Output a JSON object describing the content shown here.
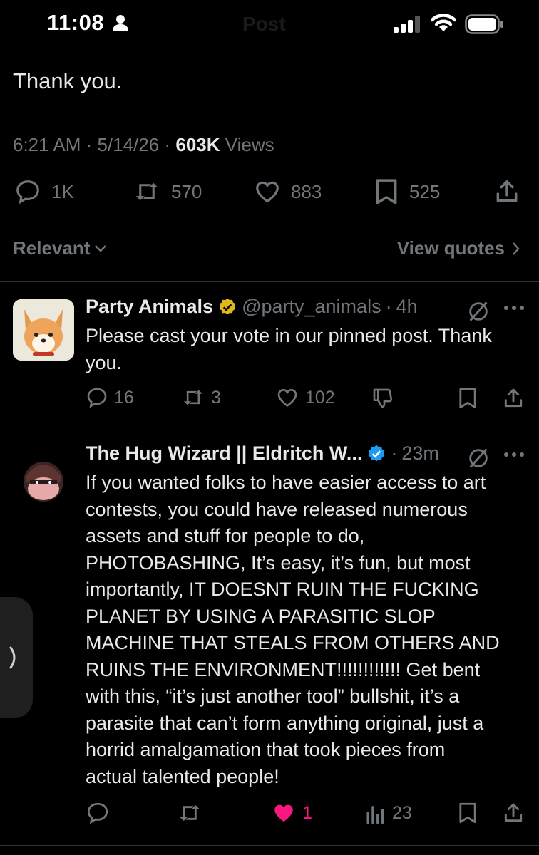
{
  "status_bar": {
    "time": "11:08",
    "header_title": "Post",
    "icons": [
      "person-icon",
      "signal-icon",
      "wifi-icon",
      "battery-icon"
    ]
  },
  "post": {
    "text": "Thank you.",
    "time": "6:21 AM",
    "date": "5/14/26",
    "views_count": "603K",
    "views_label": "Views",
    "actions": {
      "replies": "1K",
      "reposts": "570",
      "likes": "883",
      "bookmarks": "525"
    }
  },
  "sort": {
    "relevant_label": "Relevant",
    "view_quotes_label": "View quotes"
  },
  "replies": [
    {
      "name": "Party Animals",
      "handle": "@party_animals",
      "age": "4h",
      "verified_color": "#e2b719",
      "text": "Please cast your vote in our pinned post. Thank\nyou.",
      "stats": {
        "replies": "16",
        "reposts": "3",
        "likes": "102"
      }
    },
    {
      "name": "The Hug Wizard || Eldritch W...",
      "handle": "",
      "age": "23m",
      "verified_color": "#1d9bf0",
      "text": "If you wanted folks to have easier access to art\ncontests, you could have released numerous\nassets and stuff for people to do,\nPHOTOBASHING, It’s easy, it’s fun, but most\nimportantly, IT DOESNT RUIN THE FUCKING\nPLANET BY USING A PARASITIC SLOP\nMACHINE THAT STEALS FROM OTHERS AND\nRUINS THE ENVIRONMENT!!!!!!!!!!!! Get bent\nwith this, “it’s just another tool” bullshit, it’s a\nparasite that can’t form anything original, just a\nhorrid amalgamation that took pieces from\nactual talented people!",
      "stats": {
        "likes": "1",
        "views": "23"
      }
    }
  ],
  "colors": {
    "background": "#000000",
    "text": "#e7e9ea",
    "muted": "#71767b",
    "like_active": "#f91880",
    "verified_blue": "#1d9bf0",
    "verified_gold": "#e2b719"
  }
}
